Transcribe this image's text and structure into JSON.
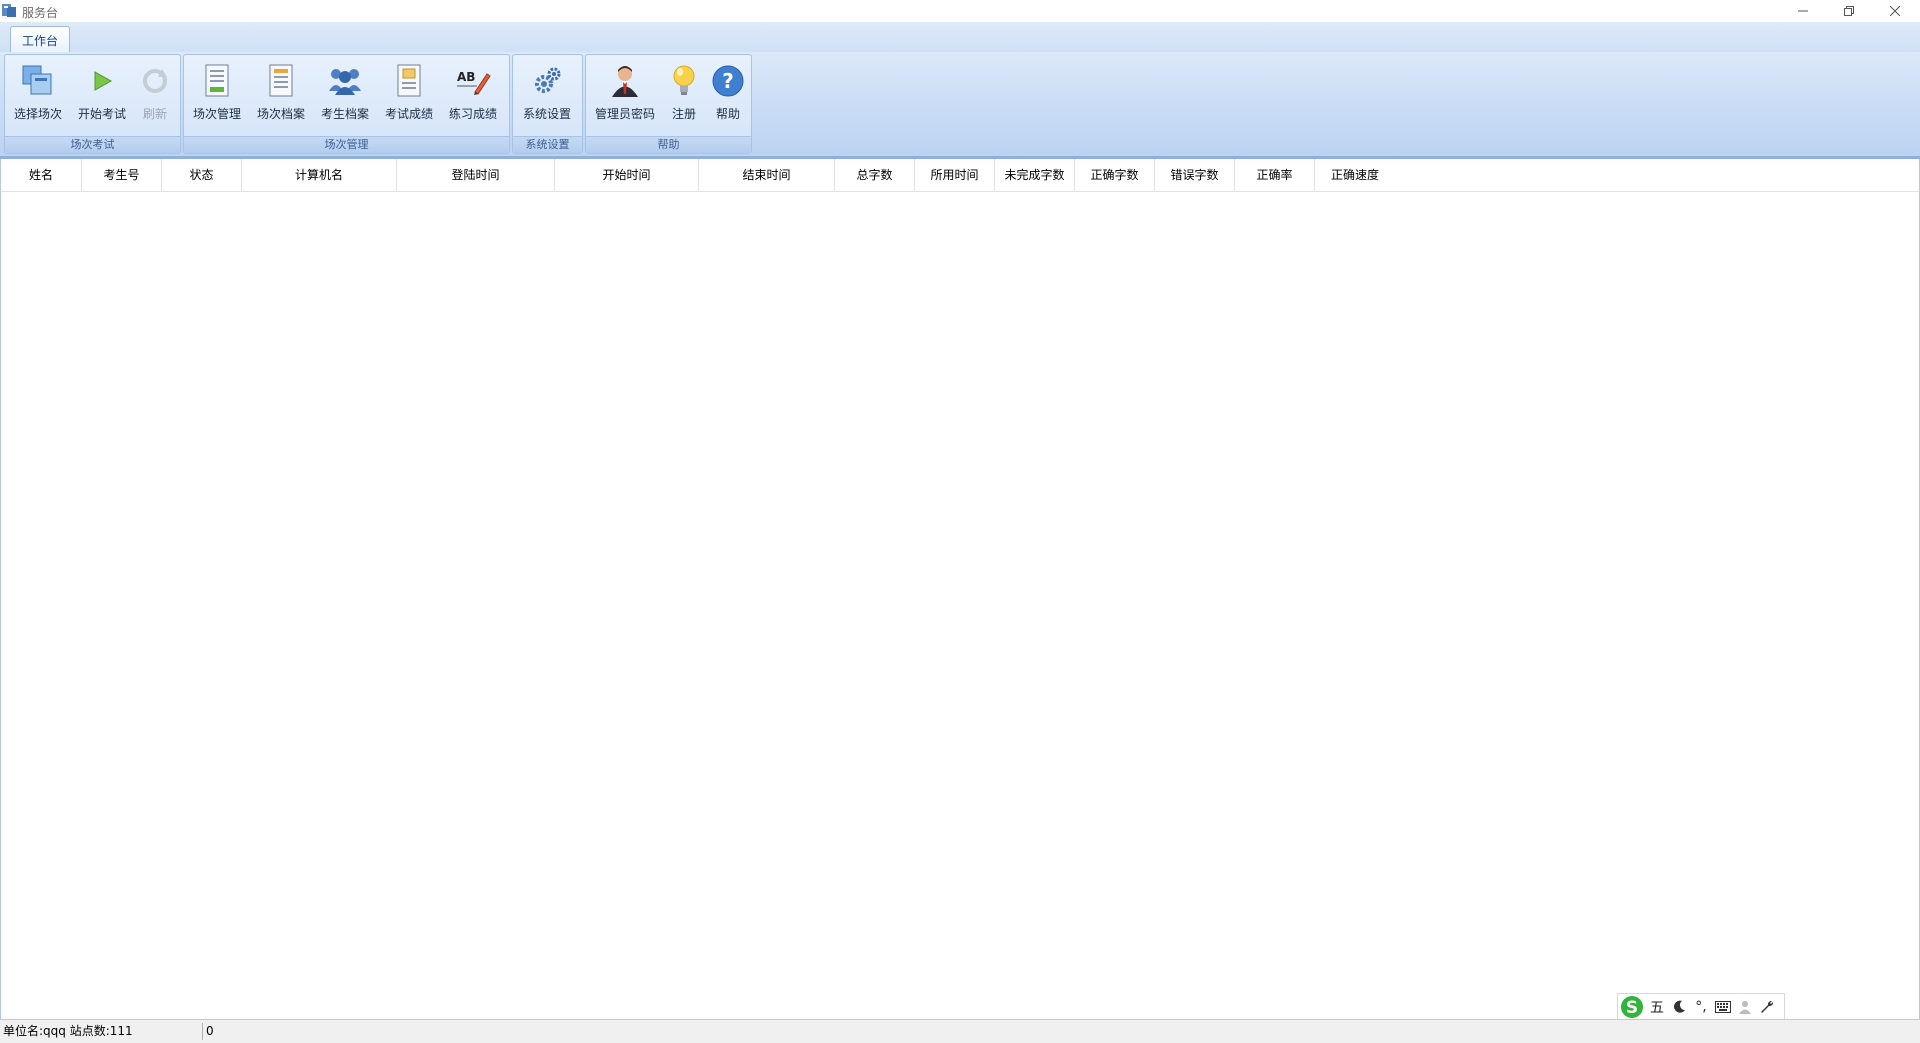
{
  "window": {
    "title": "服务台",
    "controls": [
      "minimize-icon",
      "restore-icon",
      "close-icon"
    ]
  },
  "ribbon": {
    "tabs": [
      {
        "label": "工作台",
        "active": true
      }
    ],
    "groups": [
      {
        "caption": "场次考试",
        "buttons": [
          {
            "label": "选择场次",
            "icon": "select-session-icon",
            "enabled": true
          },
          {
            "label": "开始考试",
            "icon": "play-icon",
            "enabled": true
          },
          {
            "label": "刷新",
            "icon": "refresh-icon",
            "enabled": false
          }
        ]
      },
      {
        "caption": "场次管理",
        "buttons": [
          {
            "label": "场次管理",
            "icon": "session-document-icon",
            "enabled": true
          },
          {
            "label": "场次档案",
            "icon": "session-archive-icon",
            "enabled": true
          },
          {
            "label": "考生档案",
            "icon": "users-icon",
            "enabled": true
          },
          {
            "label": "考试成绩",
            "icon": "exam-score-icon",
            "enabled": true
          },
          {
            "label": "练习成绩",
            "icon": "spelling-pencil-icon",
            "enabled": true
          }
        ]
      },
      {
        "caption": "系统设置",
        "buttons": [
          {
            "label": "系统设置",
            "icon": "gears-icon",
            "enabled": true
          }
        ]
      },
      {
        "caption": "帮助",
        "buttons": [
          {
            "label": "管理员密码",
            "icon": "admin-user-icon",
            "enabled": true
          },
          {
            "label": "注册",
            "icon": "lightbulb-icon",
            "enabled": true
          },
          {
            "label": "帮助",
            "icon": "help-icon",
            "enabled": true
          }
        ]
      }
    ]
  },
  "table": {
    "columns": [
      "姓名",
      "考生号",
      "状态",
      "计算机名",
      "登陆时间",
      "开始时间",
      "结束时间",
      "总字数",
      "所用时间",
      "未完成字数",
      "正确字数",
      "错误字数",
      "正确率",
      "正确速度"
    ],
    "rows": []
  },
  "statusbar": {
    "org_info": "单位名:qqq 站点数:111",
    "count": "0"
  },
  "ime": {
    "logo": "S",
    "mode": "五",
    "items": [
      "moon-icon",
      "punctuation-icon",
      "keyboard-icon",
      "user-icon",
      "wrench-icon"
    ],
    "punctuation": "°,",
    "colors": {
      "logo": "#2fb53a"
    }
  },
  "colors": {
    "ribbon_bg": "#c7dbf5",
    "ribbon_border": "#8fb0dc",
    "tab_text": "#15428b"
  }
}
